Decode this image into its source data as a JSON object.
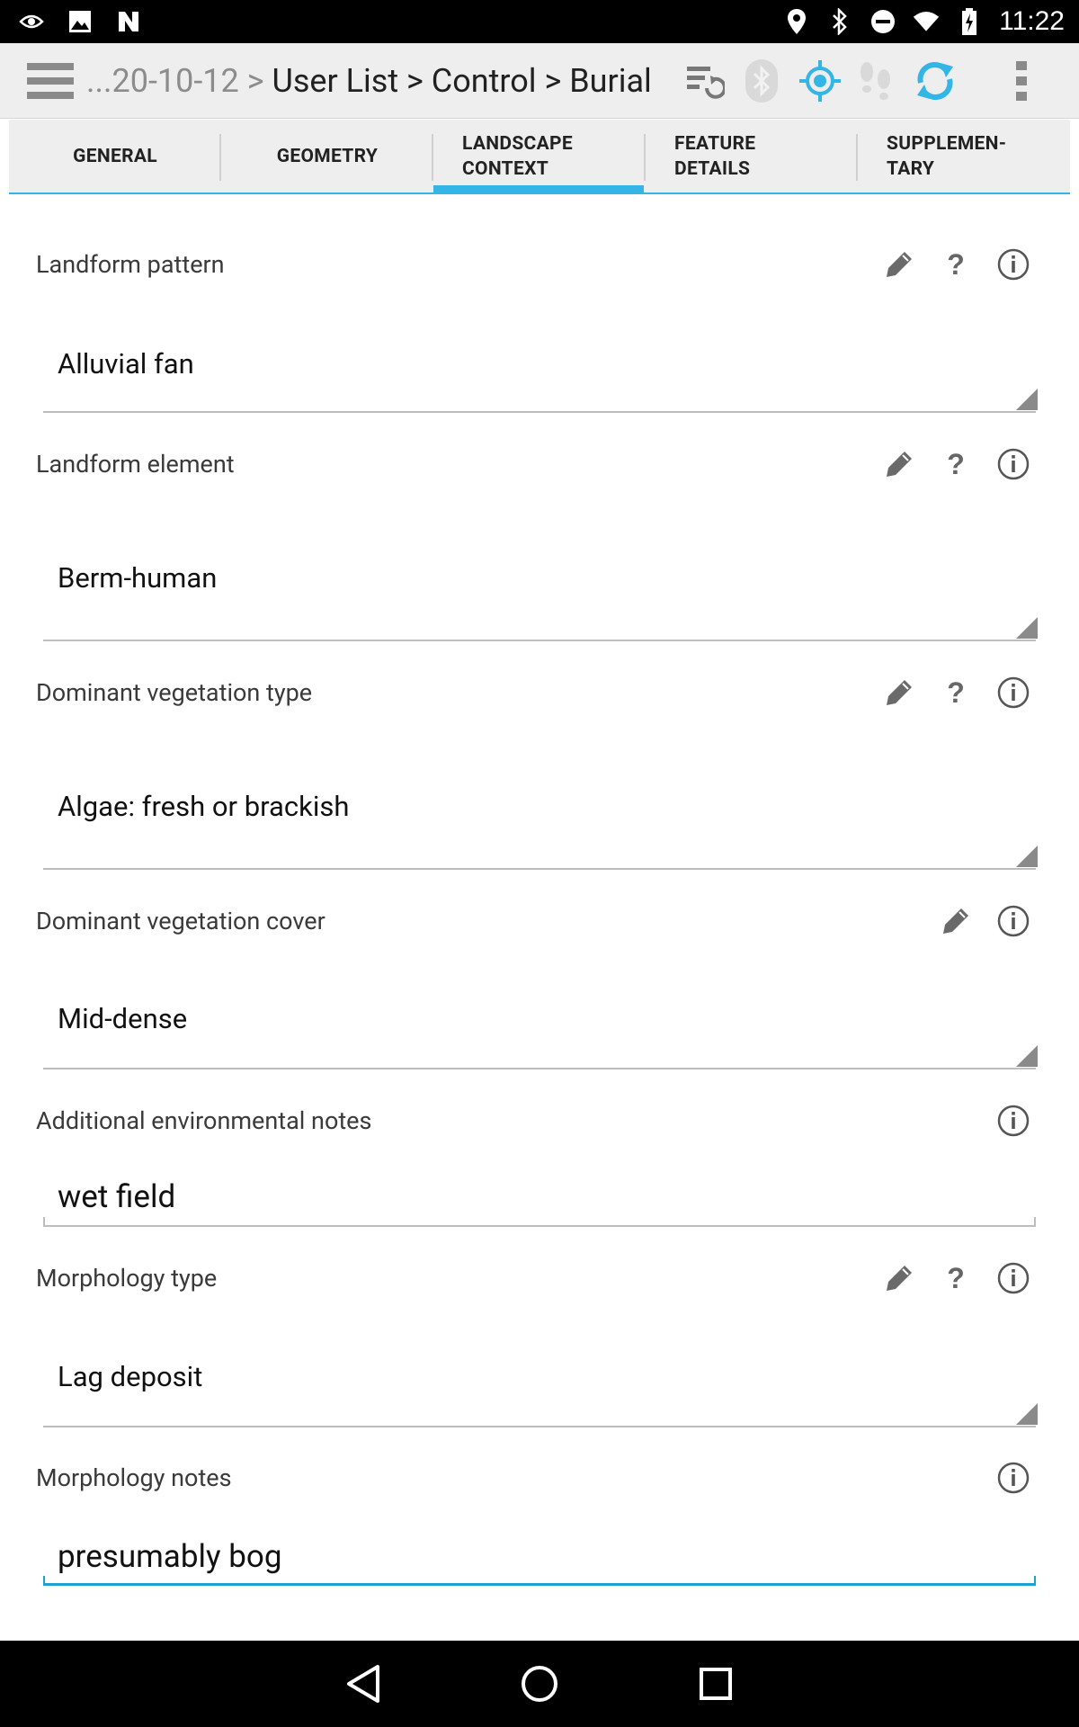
{
  "status_bar": {
    "time": "11:22",
    "left_icons": [
      "eye-notification-icon",
      "image-notification-icon",
      "nfc-icon"
    ],
    "right_icons": [
      "location-icon",
      "bluetooth-icon",
      "do-not-disturb-icon",
      "wifi-icon",
      "battery-charging-icon"
    ]
  },
  "action_bar": {
    "breadcrumb_prefix": "...20-10-12 > ",
    "breadcrumb_main": "User List > Control > Burial",
    "icons": [
      "sync-records-icon",
      "bluetooth-icon",
      "gps-icon",
      "tracking-footsteps-icon",
      "sync-icon",
      "overflow-menu-icon"
    ]
  },
  "tabs": [
    {
      "label": "GENERAL"
    },
    {
      "label": "GEOMETRY"
    },
    {
      "label_line1": "LANDSCAPE",
      "label_line2": "CONTEXT",
      "active": true
    },
    {
      "label_line1": "FEATURE",
      "label_line2": "DETAILS"
    },
    {
      "label_line1": "SUPPLEMEN-",
      "label_line2": "TARY"
    }
  ],
  "fields": [
    {
      "label": "Landform pattern",
      "value": "Alluvial fan"
    },
    {
      "label": "Landform element",
      "value": "Berm-human"
    },
    {
      "label": "Dominant vegetation type",
      "value": "Algae: fresh or brackish"
    },
    {
      "label": "Dominant vegetation cover",
      "value": "Mid-dense"
    },
    {
      "label": "Additional environmental notes",
      "value": "wet field"
    },
    {
      "label": "Morphology type",
      "value": "Lag deposit"
    },
    {
      "label": "Morphology notes",
      "value": "presumably bog"
    }
  ],
  "help_glyph": "?",
  "colors": {
    "accent": "#33b5e5",
    "active_underline": "#1fa0d0",
    "statusbar": "#000000",
    "actionbar": "#eeeeee"
  }
}
